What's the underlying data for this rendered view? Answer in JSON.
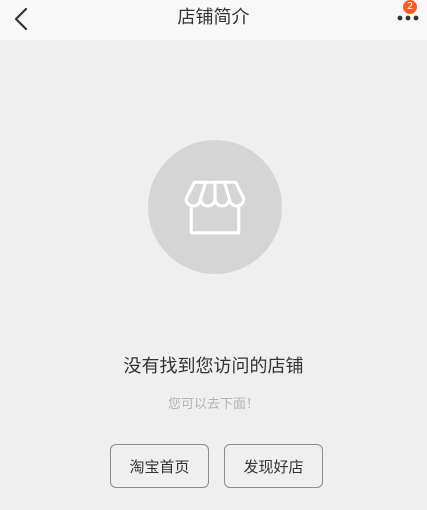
{
  "header": {
    "title": "店铺简介",
    "back_icon": "chevron-left-icon",
    "more_icon": "more-dots-icon",
    "badge_count": "2"
  },
  "empty_state": {
    "icon": "storefront-icon",
    "message": "没有找到您访问的店铺",
    "hint": "您可以去下面！"
  },
  "actions": {
    "home_label": "淘宝首页",
    "discover_label": "发现好店"
  },
  "colors": {
    "background": "#efefef",
    "header_background": "#f8f8f8",
    "badge": "#ff5a1f",
    "icon_circle": "#d5d5d5",
    "button_border": "#8c8c8c"
  }
}
